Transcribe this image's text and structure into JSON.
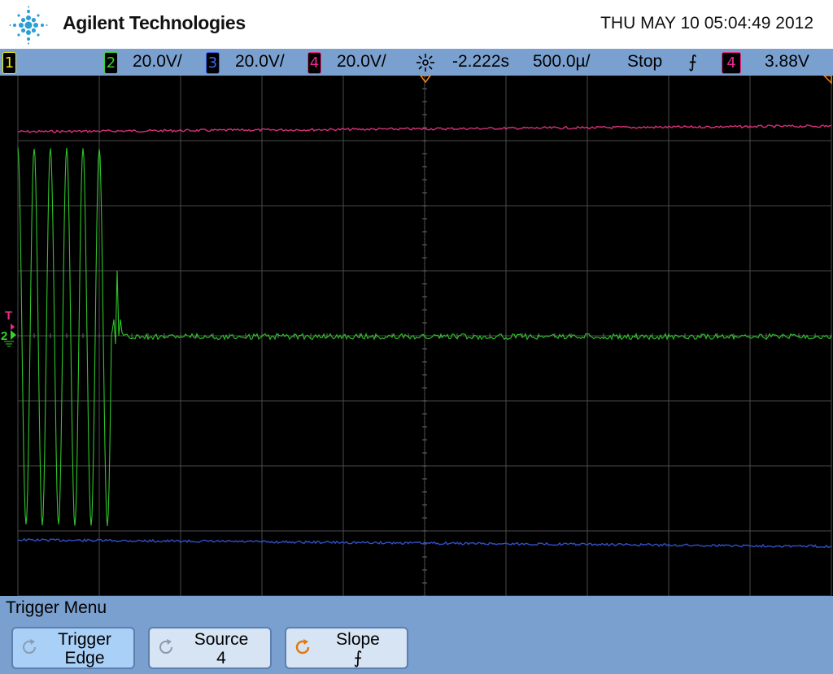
{
  "header": {
    "brand": "Agilent Technologies",
    "datetime": "THU MAY 10 05:04:49 2012"
  },
  "status_bar": {
    "channels": [
      {
        "number": "1",
        "color": "#f2e600"
      },
      {
        "number": "2",
        "scale": "20.0V/",
        "color": "#39d12c"
      },
      {
        "number": "3",
        "scale": "20.0V/",
        "color": "#3d63f5"
      },
      {
        "number": "4",
        "scale": "20.0V/",
        "color": "#ee2a8e"
      }
    ],
    "trigger_delay": "-2.222s",
    "timebase": "500.0µ/",
    "run_state": "Stop",
    "slope_symbol": "⨍",
    "trigger_source": "4",
    "trigger_level": "3.88V",
    "icons": [
      "trigger-position-icon",
      "falling-edge-icon"
    ]
  },
  "display": {
    "grid_divisions": {
      "x": 10,
      "y": 8
    },
    "markers": {
      "trigger_level": "T",
      "channel_2_ground": "2"
    },
    "traces": [
      {
        "channel": "4",
        "color": "#d4307a",
        "description": "flat trace near top"
      },
      {
        "channel": "2",
        "color": "#2fc52a",
        "description": "burst of 6 oscillations at left then flat noisy line at center"
      },
      {
        "channel": "3",
        "color": "#3050c8",
        "description": "flat trace near bottom"
      }
    ]
  },
  "menu": {
    "title": "Trigger Menu",
    "softkeys": [
      {
        "line1": "Trigger",
        "line2": "Edge",
        "icon": "rotate-knob-icon"
      },
      {
        "line1": "Source",
        "line2": "4",
        "icon": "rotate-knob-icon"
      },
      {
        "line1": "Slope",
        "line2": "⨍",
        "icon": "rotate-knob-active-icon"
      }
    ]
  }
}
